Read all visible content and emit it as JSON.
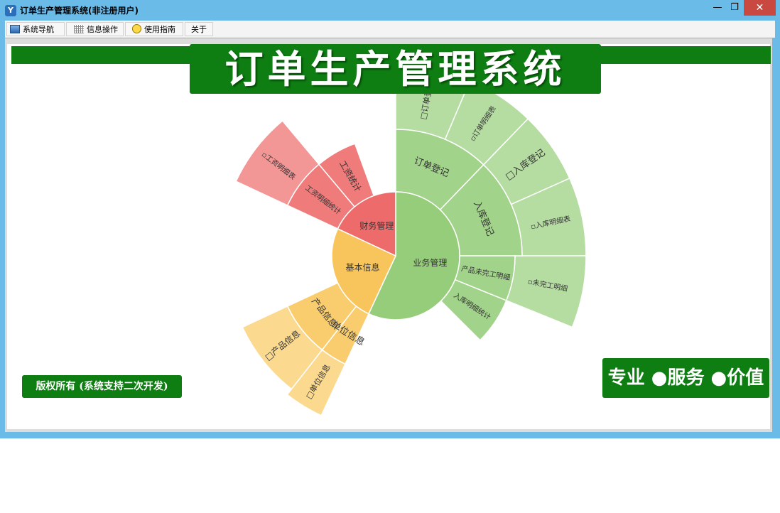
{
  "window": {
    "title": "订单生产管理系统(非注册用户)",
    "controls": {
      "minimize": "—",
      "maximize": "❐",
      "close": "✕"
    }
  },
  "menu": [
    {
      "label": "系统导航",
      "icon": "window-icon"
    },
    {
      "label": "信息操作",
      "icon": "grid-icon"
    },
    {
      "label": "使用指南",
      "icon": "bulb-icon"
    },
    {
      "label": "关于",
      "icon": ""
    }
  ],
  "banner": {
    "title": "订单生产管理系统"
  },
  "copyright": "版权所有 (系统支持二次开发)",
  "slogan": "专业 ●服务 ●价值",
  "colors": {
    "green": "#0e7d12",
    "red": "#ef6b6b",
    "yellow": "#f8c55c",
    "lightgreen": "#9bd17f"
  },
  "chart_data": {
    "type": "sunburst",
    "levels": [
      {
        "name": "业务管理",
        "color": "#96cd7a",
        "children": [
          {
            "name": "订单登记",
            "children": [
              "□订单登记",
              "▫订单明细表"
            ]
          },
          {
            "name": "入库登记",
            "children": [
              "□入库登记",
              "▫入库明细表"
            ]
          },
          {
            "name": "产品未完工明细",
            "children": [
              "▫未完工明细"
            ]
          },
          {
            "name": "入库明细统计",
            "children": []
          }
        ]
      },
      {
        "name": "基本信息",
        "color": "#f8c55c",
        "children": [
          {
            "name": "产品信息",
            "children": [
              "□产品信息"
            ]
          },
          {
            "name": "单位信息",
            "children": [
              "□单位信息"
            ]
          }
        ]
      },
      {
        "name": "财务管理",
        "color": "#ee6b6b",
        "children": [
          {
            "name": "工资明细统计",
            "children": [
              "▫工资明细表"
            ]
          },
          {
            "name": "工资统计",
            "children": []
          }
        ]
      }
    ]
  }
}
